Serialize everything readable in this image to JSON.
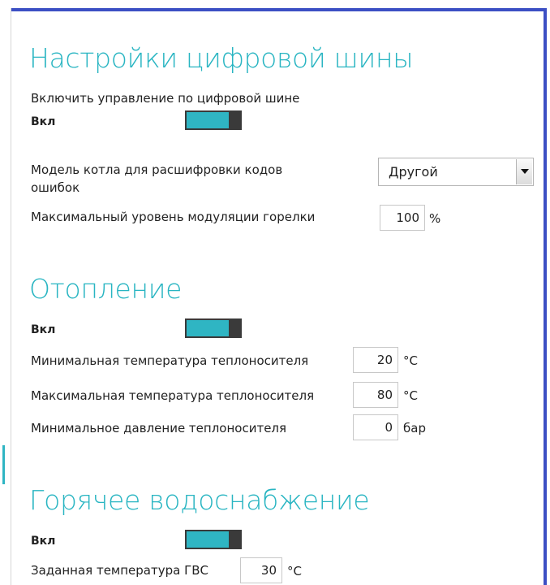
{
  "digital_bus": {
    "title": "Настройки цифровой шины",
    "enable_label": "Включить управление по цифровой шине",
    "state_label": "Вкл",
    "toggle_on": true,
    "boiler_model_label": "Модель котла для расшифровки кодов ошибок",
    "boiler_model_value": "Другой",
    "modulation_label": "Максимальный уровень модуляции горелки",
    "modulation_value": "100",
    "modulation_unit": "%"
  },
  "heating": {
    "title": "Отопление",
    "state_label": "Вкл",
    "toggle_on": true,
    "min_temp_label": "Минимальная температура теплоносителя",
    "min_temp_value": "20",
    "max_temp_label": "Максимальная температура теплоносителя",
    "max_temp_value": "80",
    "temp_unit": "°C",
    "min_pressure_label": "Минимальное давление теплоносителя",
    "min_pressure_value": "0",
    "pressure_unit": "бар"
  },
  "hot_water": {
    "title": "Горячее водоснабжение",
    "state_label": "Вкл",
    "toggle_on": true,
    "set_temp_label": "Заданная температура ГВС",
    "set_temp_value": "30",
    "temp_unit": "°C"
  },
  "colors": {
    "accent": "#2fb5c3",
    "frame": "#3c4fc4",
    "toggle_thumb": "#3a3a3a"
  }
}
